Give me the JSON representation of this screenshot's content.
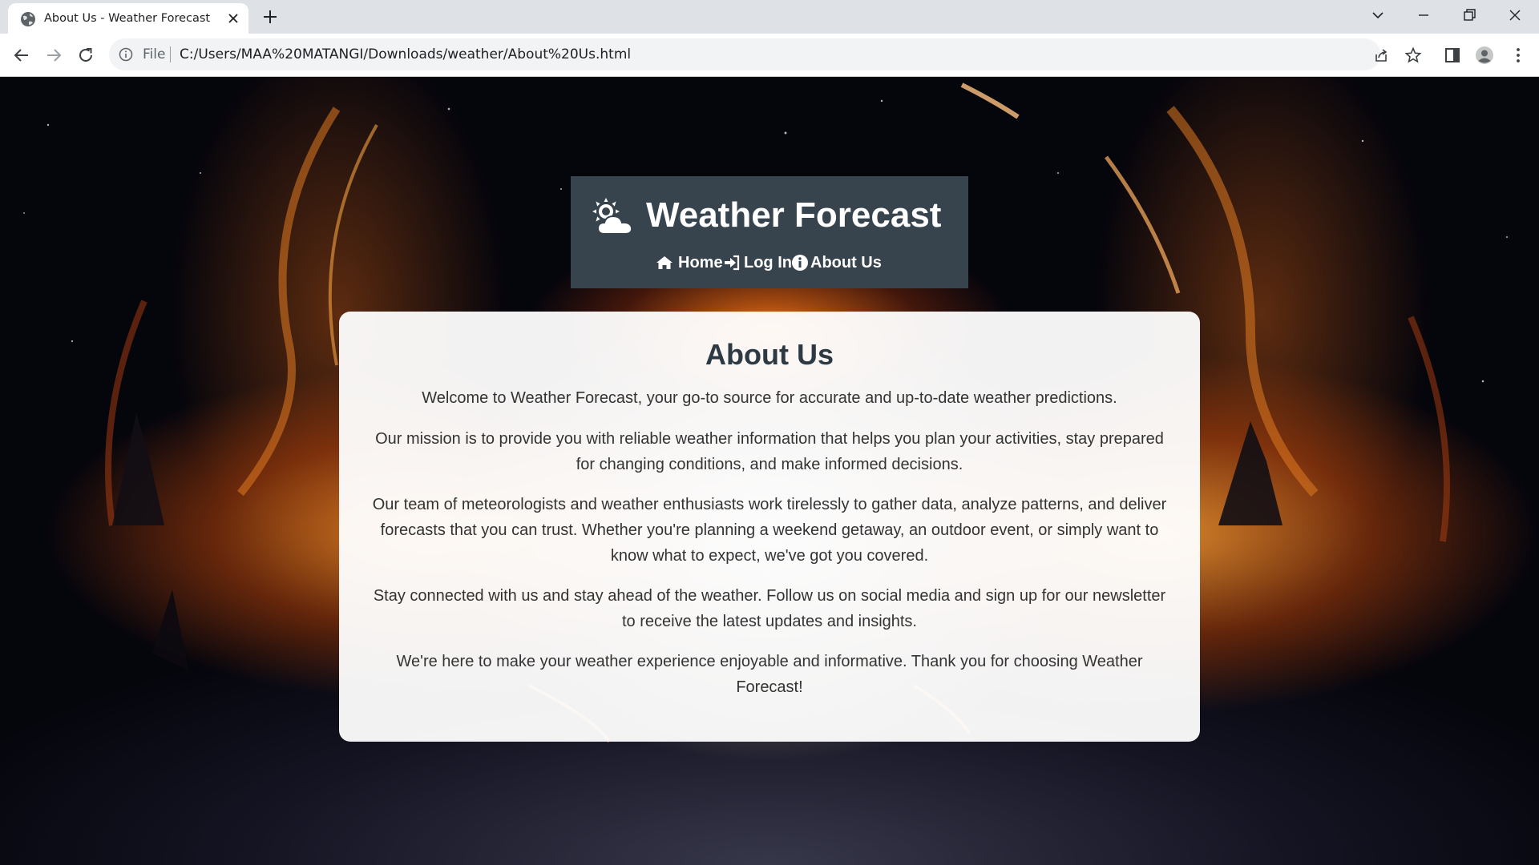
{
  "browser": {
    "tab_title": "About Us - Weather Forecast",
    "file_label": "File",
    "url": "C:/Users/MAA%20MATANGI/Downloads/weather/About%20Us.html"
  },
  "header": {
    "title": "Weather Forecast",
    "nav": [
      {
        "label": "Home",
        "icon": "home-icon"
      },
      {
        "label": "Log In",
        "icon": "sign-in-icon"
      },
      {
        "label": "About Us",
        "icon": "info-circle-icon"
      }
    ]
  },
  "about": {
    "heading": "About Us",
    "paragraphs": [
      "Welcome to Weather Forecast, your go-to source for accurate and up-to-date weather predictions.",
      "Our mission is to provide you with reliable weather information that helps you plan your activities, stay prepared for changing conditions, and make informed decisions.",
      "Our team of meteorologists and weather enthusiasts work tirelessly to gather data, analyze patterns, and deliver forecasts that you can trust. Whether you're planning a weekend getaway, an outdoor event, or simply want to know what to expect, we've got you covered.",
      "Stay connected with us and stay ahead of the weather. Follow us on social media and sign up for our newsletter to receive the latest updates and insights.",
      "We're here to make your weather experience enjoyable and informative. Thank you for choosing Weather Forecast!"
    ]
  },
  "colors": {
    "header_bg": "#37434d",
    "card_bg": "#ffffff",
    "heading_text": "#2d3a44",
    "body_text": "#333333"
  }
}
